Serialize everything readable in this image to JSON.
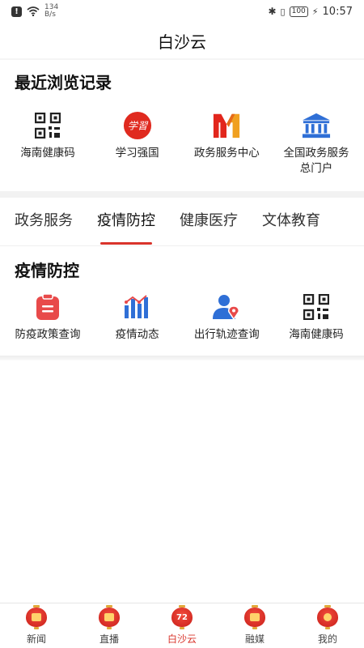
{
  "status_bar": {
    "net_speed_value": "134",
    "net_speed_unit": "B/s",
    "battery": "100",
    "time": "10:57"
  },
  "header": {
    "title": "白沙云"
  },
  "recent": {
    "title": "最近浏览记录",
    "items": [
      {
        "label": "海南健康码",
        "icon": "qr-code-icon"
      },
      {
        "label": "学习强国",
        "icon": "xuexi-qiangguo-logo"
      },
      {
        "label": "政务服务中心",
        "icon": "government-service-logo"
      },
      {
        "label": "全国政务服务总门户",
        "icon": "government-building-icon"
      }
    ]
  },
  "tabs": [
    {
      "label": "政务服务",
      "active": false
    },
    {
      "label": "疫情防控",
      "active": true
    },
    {
      "label": "健康医疗",
      "active": false
    },
    {
      "label": "文体教育",
      "active": false
    }
  ],
  "epidemic": {
    "title": "疫情防控",
    "items": [
      {
        "label": "防疫政策查询",
        "icon": "clipboard-icon"
      },
      {
        "label": "疫情动态",
        "icon": "bar-chart-icon"
      },
      {
        "label": "出行轨迹查询",
        "icon": "person-location-icon"
      },
      {
        "label": "海南健康码",
        "icon": "qr-code-icon"
      }
    ]
  },
  "bottom_nav": [
    {
      "label": "新闻",
      "active": false
    },
    {
      "label": "直播",
      "active": false
    },
    {
      "label": "白沙云",
      "badge": "72",
      "active": true
    },
    {
      "label": "融媒",
      "active": false
    },
    {
      "label": "我的",
      "active": false
    }
  ],
  "colors": {
    "accent": "#d9342b",
    "blue": "#2f6fd6"
  }
}
